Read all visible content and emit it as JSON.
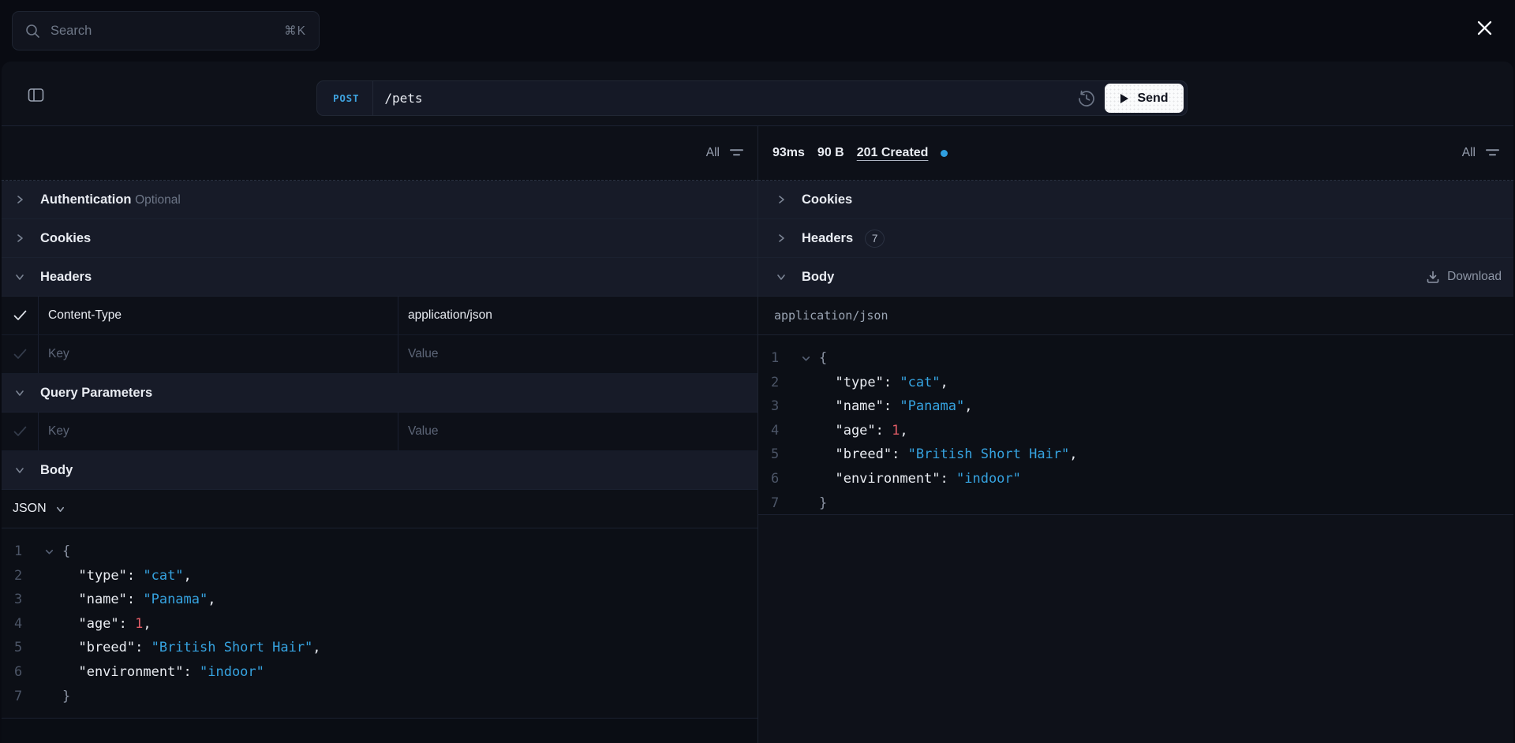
{
  "topbar": {
    "search_placeholder": "Search",
    "search_shortcut": "⌘K"
  },
  "toolbar": {
    "method": "POST",
    "url": "/pets",
    "send_label": "Send"
  },
  "request": {
    "filter_label": "All",
    "sections": {
      "authentication": {
        "label": "Authentication",
        "badge": "Optional"
      },
      "cookies": {
        "label": "Cookies"
      },
      "headers": {
        "label": "Headers"
      },
      "query_parameters": {
        "label": "Query Parameters"
      },
      "body": {
        "label": "Body"
      }
    },
    "headers_table": {
      "rows": [
        {
          "key": "Content-Type",
          "value": "application/json",
          "checked": true
        }
      ],
      "placeholder_key": "Key",
      "placeholder_value": "Value"
    },
    "query_table": {
      "placeholder_key": "Key",
      "placeholder_value": "Value"
    },
    "body_type": "JSON"
  },
  "response": {
    "filter_label": "All",
    "duration": "93ms",
    "size": "90 B",
    "status": "201 Created",
    "sections": {
      "cookies": {
        "label": "Cookies"
      },
      "headers": {
        "label": "Headers",
        "badge": "7"
      },
      "body": {
        "label": "Body"
      }
    },
    "download_label": "Download",
    "content_type": "application/json"
  },
  "code": {
    "lines": [
      {
        "n": "1",
        "fold": true,
        "segs": [
          {
            "t": "{",
            "c": "brace"
          }
        ]
      },
      {
        "n": "2",
        "fold": false,
        "segs": [
          {
            "t": "  \"type\": ",
            "c": "key"
          },
          {
            "t": "\"cat\"",
            "c": "str"
          },
          {
            "t": ",",
            "c": "plain"
          }
        ]
      },
      {
        "n": "3",
        "fold": false,
        "segs": [
          {
            "t": "  \"name\": ",
            "c": "key"
          },
          {
            "t": "\"Panama\"",
            "c": "str"
          },
          {
            "t": ",",
            "c": "plain"
          }
        ]
      },
      {
        "n": "4",
        "fold": false,
        "segs": [
          {
            "t": "  \"age\": ",
            "c": "key"
          },
          {
            "t": "1",
            "c": "num"
          },
          {
            "t": ",",
            "c": "plain"
          }
        ]
      },
      {
        "n": "5",
        "fold": false,
        "segs": [
          {
            "t": "  \"breed\": ",
            "c": "key"
          },
          {
            "t": "\"British Short Hair\"",
            "c": "str"
          },
          {
            "t": ",",
            "c": "plain"
          }
        ]
      },
      {
        "n": "6",
        "fold": false,
        "segs": [
          {
            "t": "  \"environment\": ",
            "c": "key"
          },
          {
            "t": "\"indoor\"",
            "c": "str"
          }
        ]
      },
      {
        "n": "7",
        "fold": false,
        "segs": [
          {
            "t": "}",
            "c": "brace"
          }
        ]
      }
    ]
  },
  "colors": {
    "accent_blue": "#36a3e0",
    "number_red": "#e05c66",
    "status_dot": "#2f9fe0",
    "send_bg": "#fafbfc"
  }
}
